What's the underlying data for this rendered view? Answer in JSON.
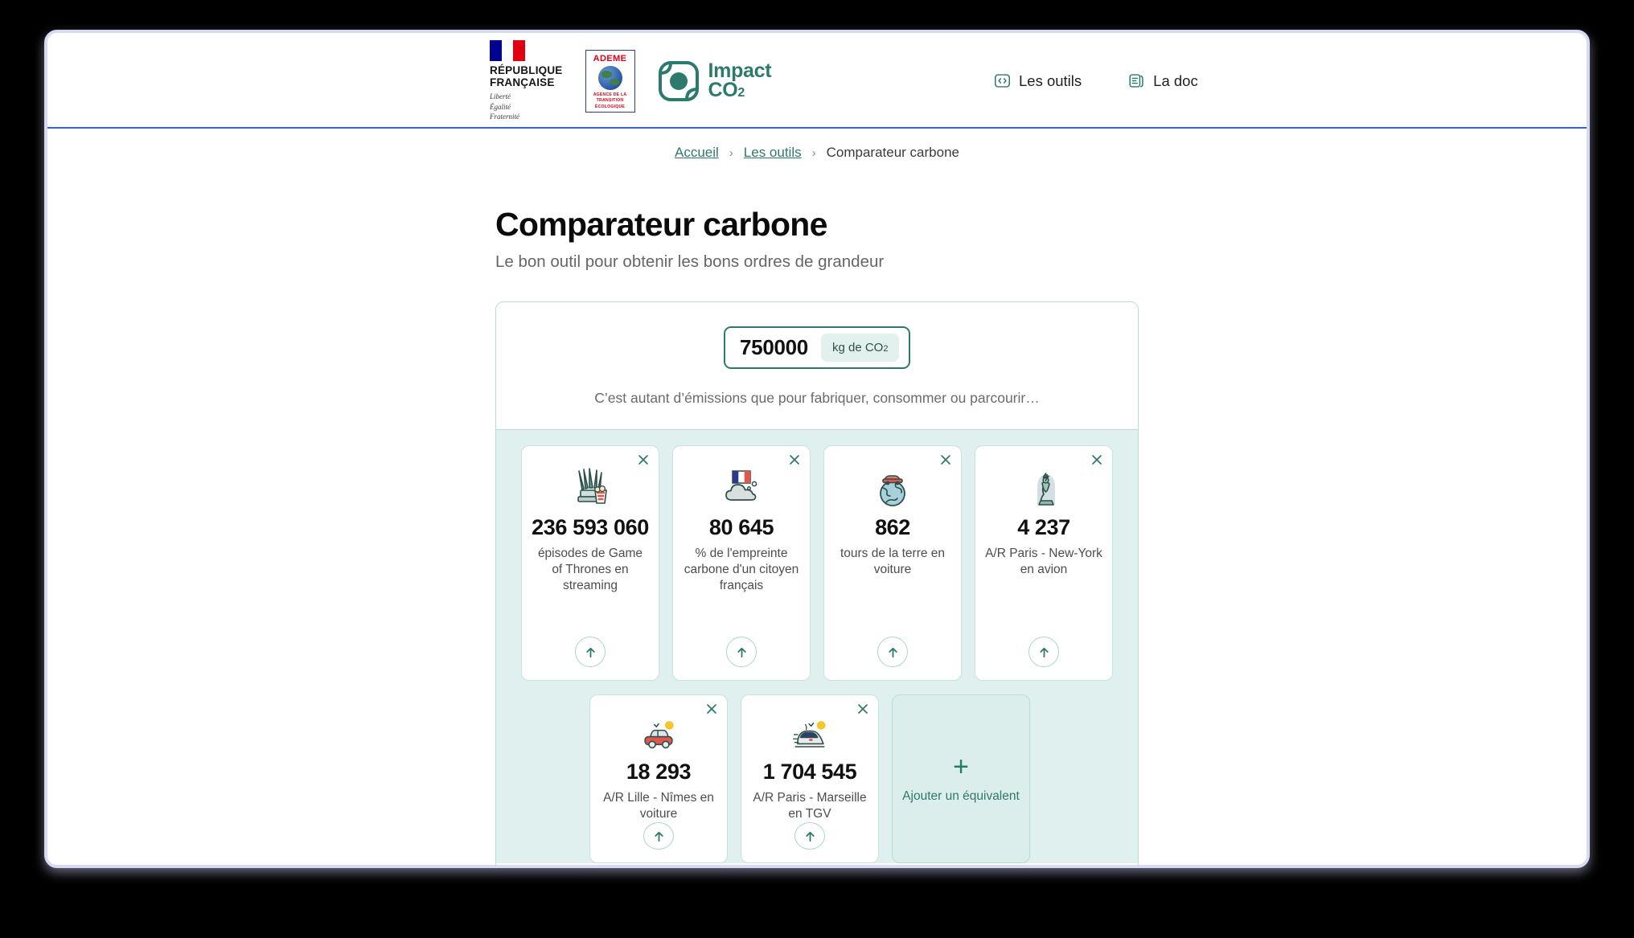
{
  "branding": {
    "republique": {
      "line1": "RÉPUBLIQUE",
      "line2": "FRANÇAISE",
      "motto_1": "Liberté",
      "motto_2": "Égalité",
      "motto_3": "Fraternité",
      "flag_icon": "french-flag-icon"
    },
    "ademe": {
      "name": "ADEME",
      "sub_line1": "AGENCE DE LA",
      "sub_line2": "TRANSITION",
      "sub_line3": "ÉCOLOGIQUE",
      "globe_icon": "globe-icon"
    },
    "impact": {
      "name": "Impact",
      "subscript_text": "CO",
      "subscript_number": "2",
      "mark_icon": "impact-co2-mark-icon",
      "color": "#2c7a6b"
    }
  },
  "header": {
    "nav": [
      {
        "label": "Les outils",
        "icon": "code-brackets-icon"
      },
      {
        "label": "La doc",
        "icon": "book-icon"
      }
    ]
  },
  "breadcrumb": {
    "items": [
      {
        "label": "Accueil",
        "link": true
      },
      {
        "label": "Les outils",
        "link": true
      },
      {
        "label": "Comparateur carbone",
        "link": false
      }
    ],
    "separator": "›"
  },
  "page": {
    "title": "Comparateur carbone",
    "subtitle": "Le bon outil pour obtenir les bons ordres de grandeur"
  },
  "tool": {
    "input": {
      "value": "750000",
      "placeholder": "750000",
      "unit_prefix": "kg de CO",
      "unit_subscript": "2",
      "accent_color": "#2c7a6b"
    },
    "helper_text": "C’est autant d’émissions que pour fabriquer, consommer ou parcourir…",
    "results_background": "#e0f0ee"
  },
  "equivalents": {
    "row_1": [
      {
        "value": "236 593 060",
        "label": "épisodes de Game of Thrones en streaming",
        "icon": "iron-throne-popcorn-icon",
        "close_icon": "close-icon",
        "arrow_icon": "arrow-up-icon"
      },
      {
        "value": "80 645",
        "label": "% de l'empreinte carbone d'un citoyen français",
        "icon": "french-flag-cloud-icon",
        "close_icon": "close-icon",
        "arrow_icon": "arrow-up-icon"
      },
      {
        "value": "862",
        "label": "tours de la terre en voiture",
        "icon": "earth-car-icon",
        "close_icon": "close-icon",
        "arrow_icon": "arrow-up-icon"
      },
      {
        "value": "4 237",
        "label": "A/R Paris - New-York en avion",
        "icon": "statue-of-liberty-icon",
        "close_icon": "close-icon",
        "arrow_icon": "arrow-up-icon"
      }
    ],
    "row_2": [
      {
        "value": "18 293",
        "label": "A/R Lille - Nîmes en voiture",
        "icon": "red-car-sun-icon",
        "close_icon": "close-icon",
        "arrow_icon": "arrow-up-icon"
      },
      {
        "value": "1 704 545",
        "label": "A/R Paris - Marseille en TGV",
        "icon": "tgv-train-sun-icon",
        "close_icon": "close-icon",
        "arrow_icon": "arrow-up-icon"
      }
    ],
    "add_tile": {
      "plus": "+",
      "label": "Ajouter un équivalent",
      "icon": "plus-icon"
    }
  }
}
